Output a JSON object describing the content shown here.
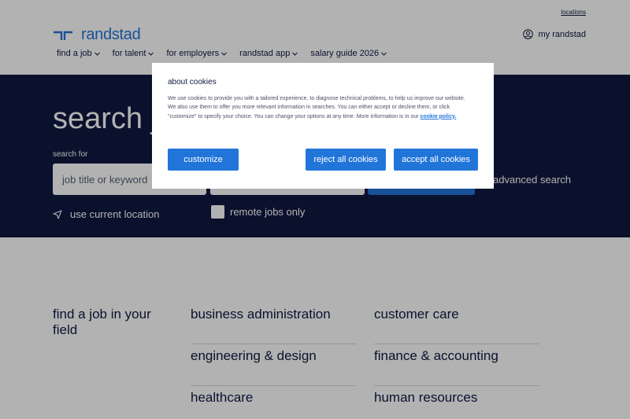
{
  "header": {
    "locations_link": "locations",
    "brand_name": "randstad",
    "my_account": "my randstad",
    "nav": [
      {
        "label": "find a job"
      },
      {
        "label": "for talent"
      },
      {
        "label": "for employers"
      },
      {
        "label": "randstad app"
      },
      {
        "label": "salary guide 2026"
      }
    ]
  },
  "hero": {
    "title": "search j",
    "search_for_label": "search for",
    "keyword_placeholder": "job title or keyword",
    "advanced_search": "advanced search",
    "use_location": "use current location",
    "remote_only": "remote jobs only"
  },
  "fields": {
    "title": "find a job in your field",
    "col1": [
      "business administration",
      "engineering & design",
      "healthcare"
    ],
    "col2": [
      "customer care",
      "finance & accounting",
      "human resources"
    ]
  },
  "cookie_modal": {
    "title": "about cookies",
    "body": "We use cookies to provide you with a tailored experience, to diagnose technical problems, to help us improve our website. We also use them to offer you more relevant information in searches. You can either accept or decline them, or click \"customize\" to specify your choice. You can change your options at any time. More information is in our ",
    "policy_link": "cookie policy.",
    "customize": "customize",
    "reject": "reject all cookies",
    "accept": "accept all cookies"
  },
  "colors": {
    "brand_blue": "#2175d9",
    "navy": "#0f1941"
  }
}
